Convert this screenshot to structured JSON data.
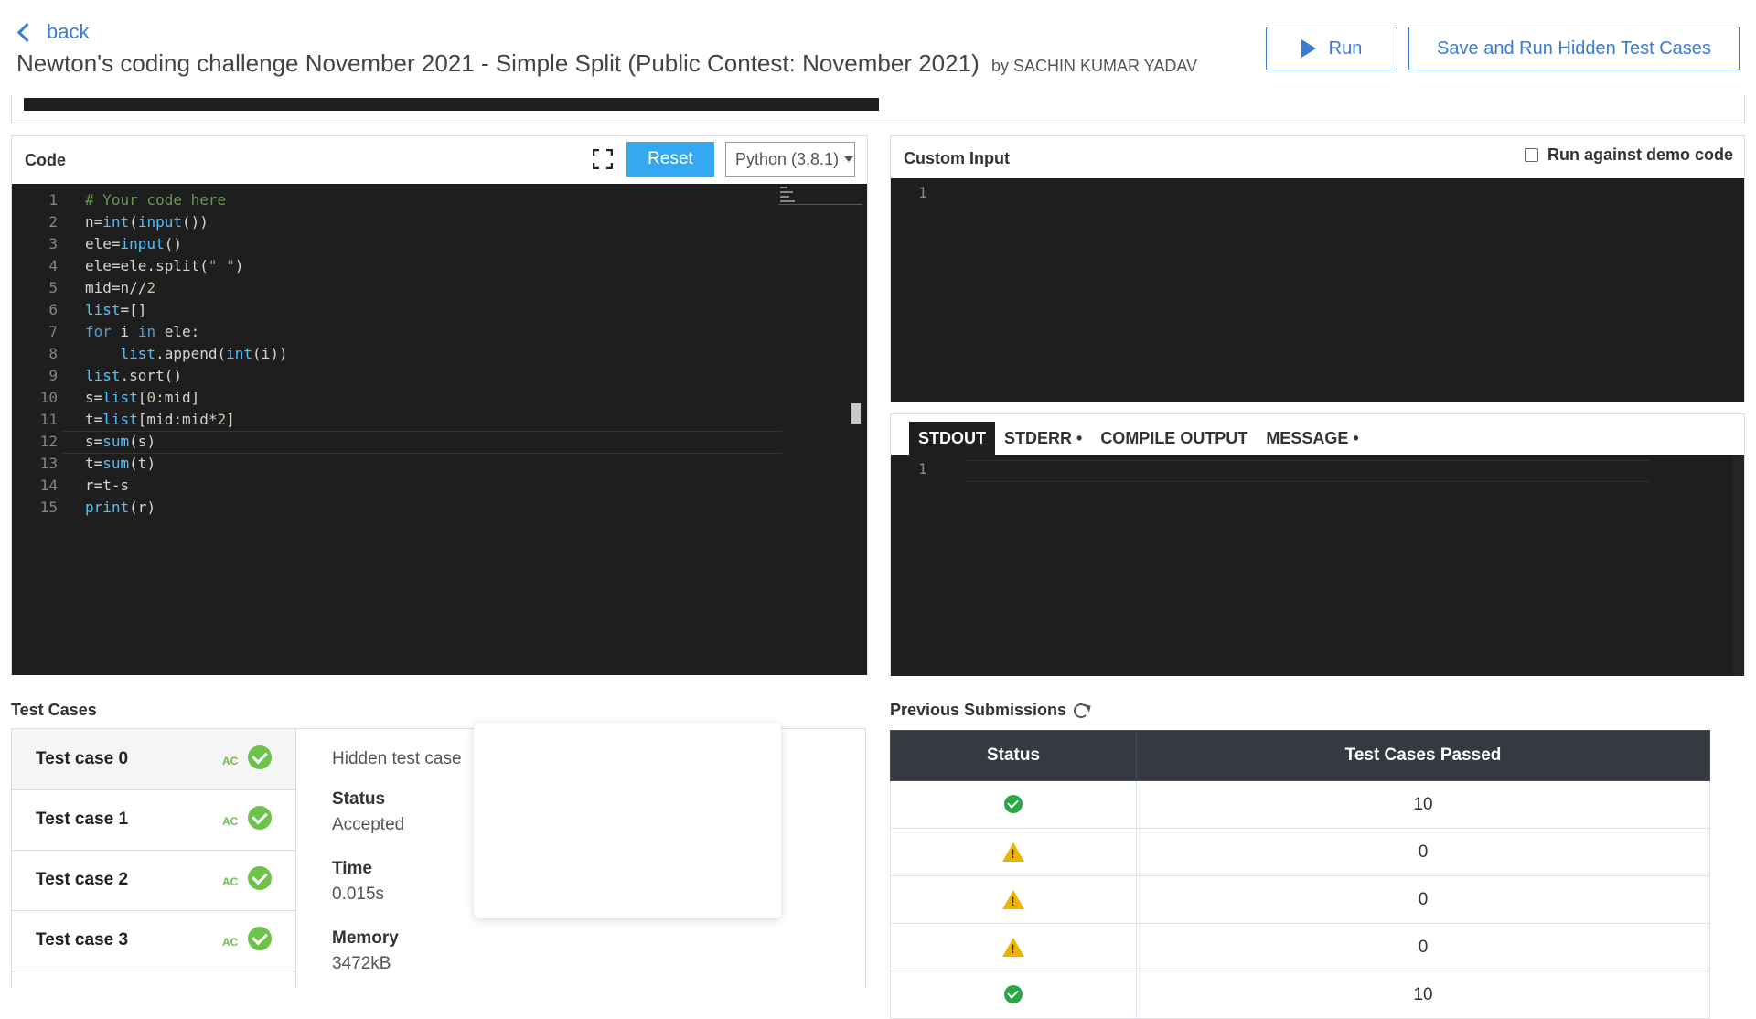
{
  "header": {
    "back_label": "back",
    "title": "Newton's coding challenge November 2021 - Simple Split (Public Contest: November 2021)",
    "author": "by SACHIN KUMAR YADAV",
    "run_label": "Run",
    "save_run_label": "Save and Run Hidden Test Cases"
  },
  "code_panel": {
    "title": "Code",
    "reset_label": "Reset",
    "language": "Python (3.8.1)",
    "lines": [
      "# Your code here",
      "n=int(input())",
      "ele=input()",
      "ele=ele.split(\" \")",
      "mid=n//2",
      "list=[]",
      "for i in ele:",
      "    list.append(int(i))",
      "list.sort()",
      "s=list[0:mid]",
      "t=list[mid:mid*2]",
      "s=sum(s)",
      "t=sum(t)",
      "r=t-s",
      "print(r)"
    ]
  },
  "custom_input": {
    "title": "Custom Input",
    "demo_label": "Run against demo code",
    "demo_checked": false,
    "line_number": "1"
  },
  "output": {
    "tabs": [
      "STDOUT",
      "STDERR •",
      "COMPILE OUTPUT",
      "MESSAGE •"
    ],
    "active_tab": "STDOUT",
    "line_number": "1"
  },
  "test_cases": {
    "title": "Test Cases",
    "items": [
      {
        "label": "Test case 0",
        "badge": "AC"
      },
      {
        "label": "Test case 1",
        "badge": "AC"
      },
      {
        "label": "Test case 2",
        "badge": "AC"
      },
      {
        "label": "Test case 3",
        "badge": "AC"
      }
    ],
    "detail": {
      "type": "Hidden test case",
      "status_label": "Status",
      "status_value": "Accepted",
      "time_label": "Time",
      "time_value": "0.015s",
      "memory_label": "Memory",
      "memory_value": "3472kB"
    }
  },
  "previous_submissions": {
    "title": "Previous Submissions",
    "columns": [
      "Status",
      "Test Cases Passed"
    ],
    "rows": [
      {
        "status": "success",
        "passed": "10"
      },
      {
        "status": "warning",
        "passed": "0"
      },
      {
        "status": "warning",
        "passed": "0"
      },
      {
        "status": "warning",
        "passed": "0"
      },
      {
        "status": "success",
        "passed": "10"
      }
    ]
  },
  "colors": {
    "accent": "#3a7bd5",
    "reset": "#34a9f2",
    "editor_bg": "#1e1e1e",
    "ac_green": "#6cc24a",
    "success": "#28a745",
    "warning": "#f0b400",
    "table_header": "#343a40"
  }
}
